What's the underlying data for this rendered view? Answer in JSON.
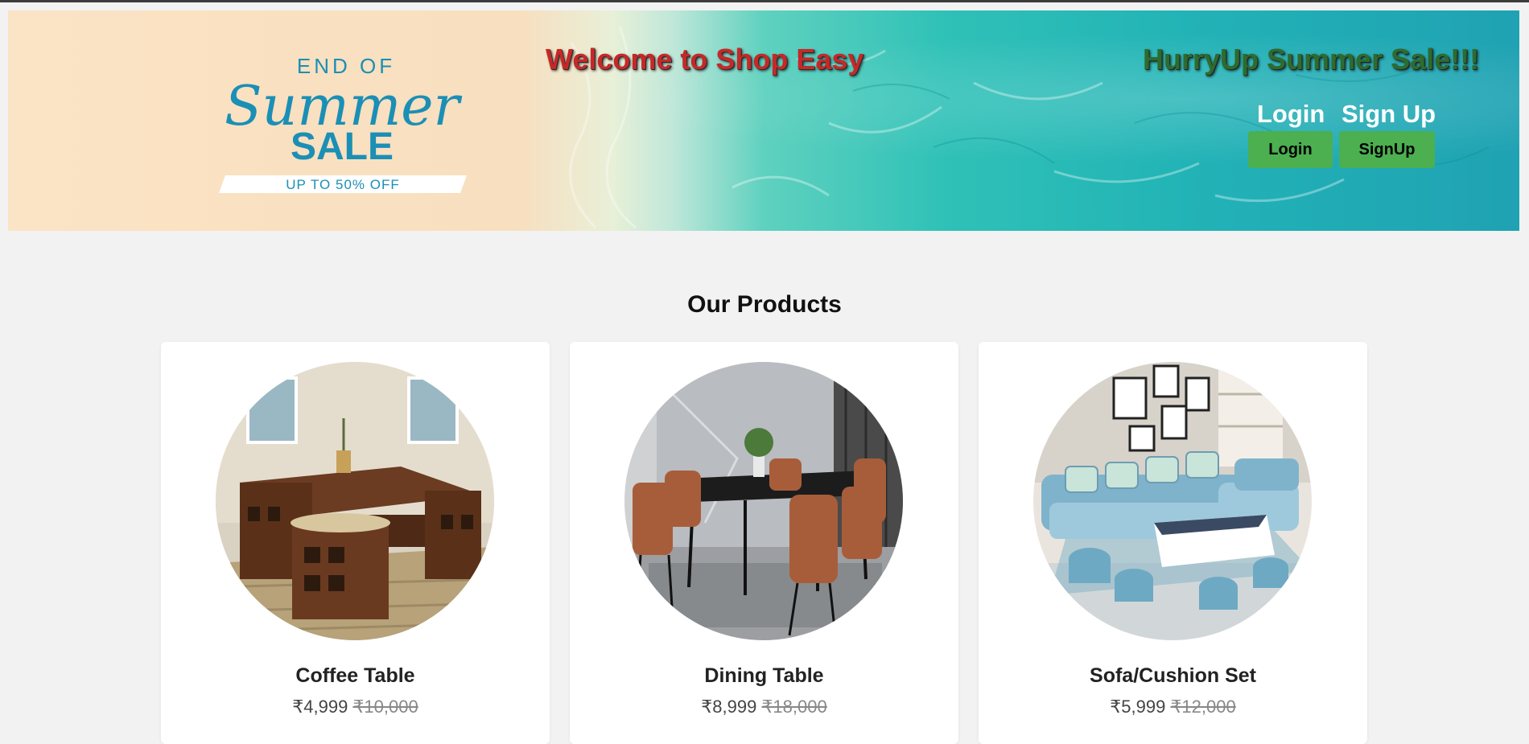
{
  "header": {
    "welcome": "Welcome to Shop Easy",
    "promo": "HurryUp Summer Sale!!!",
    "login_label": "Login",
    "signup_label": "Sign Up",
    "login_button": "Login",
    "signup_button": "SignUp"
  },
  "banner": {
    "line1": "END OF",
    "line2": "Summer",
    "line3": "SALE",
    "line4": "UP TO 50% OFF"
  },
  "products": {
    "title": "Our Products",
    "items": [
      {
        "name": "Coffee Table",
        "price": "₹4,999",
        "old_price": "₹10,000"
      },
      {
        "name": "Dining Table",
        "price": "₹8,999",
        "old_price": "₹18,000"
      },
      {
        "name": "Sofa/Cushion Set",
        "price": "₹5,999",
        "old_price": "₹12,000"
      }
    ]
  },
  "colors": {
    "page_bg": "#f2f2f2",
    "button_green": "#4caf50",
    "welcome_red": "#c62828",
    "promo_green": "#2e6b2e",
    "banner_teal": "#22b3b6",
    "banner_sand": "#fbe4c6"
  }
}
